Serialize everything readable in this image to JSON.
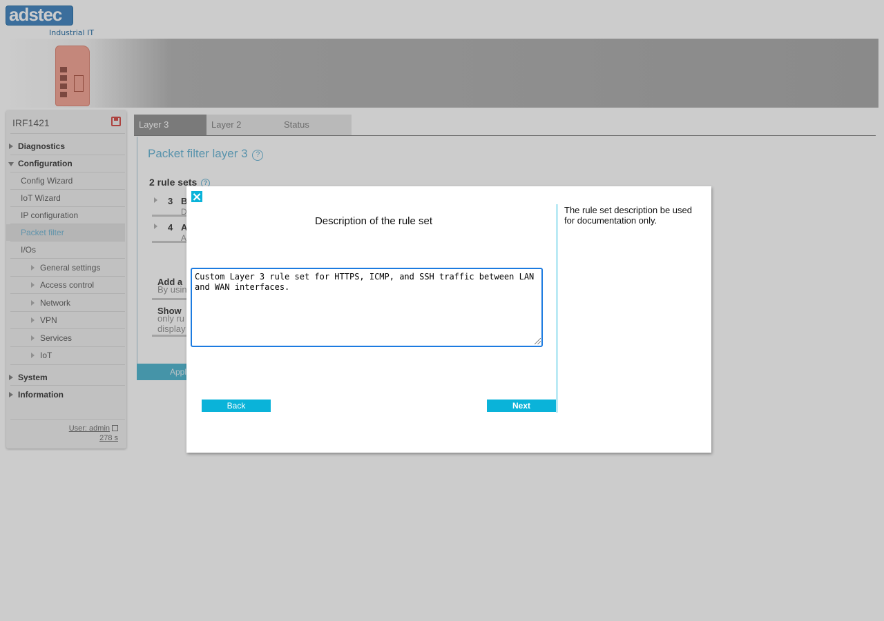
{
  "logo": {
    "text": "adstec",
    "subtitle": "Industrial IT"
  },
  "sidebar": {
    "device_name": "IRF1421",
    "items": [
      {
        "label": "Diagnostics"
      },
      {
        "label": "Configuration"
      },
      {
        "label": "Config Wizard"
      },
      {
        "label": "IoT Wizard"
      },
      {
        "label": "IP configuration"
      },
      {
        "label": "Packet filter"
      },
      {
        "label": "I/Os"
      },
      {
        "label": "General settings"
      },
      {
        "label": "Access control"
      },
      {
        "label": "Network"
      },
      {
        "label": "VPN"
      },
      {
        "label": "Services"
      },
      {
        "label": "IoT"
      },
      {
        "label": "System"
      },
      {
        "label": "Information"
      }
    ],
    "user": "User: admin",
    "timer": "278 s"
  },
  "tabs": [
    "Layer 3",
    "Layer 2",
    "Status"
  ],
  "main": {
    "title": "Packet filter layer 3",
    "rulesets_title": "2 rule sets",
    "rulesets": [
      {
        "num": "3",
        "name_fragment": "B",
        "sub_fragment": "D"
      },
      {
        "num": "4",
        "name_fragment": "A",
        "sub_fragment": "A"
      }
    ],
    "add_title": "Add a",
    "add_text": "By usin",
    "show_title": "Show",
    "show_text_1": "only ru",
    "show_text_2": "display",
    "apply_label": "Appl"
  },
  "dialog": {
    "close_label": "×",
    "title": "Description of the rule set",
    "textarea_value": "Custom Layer 3 rule set for HTTPS, ICMP, and SSH traffic between LAN and WAN interfaces.",
    "help_text": "The rule set description be used for documentation only.",
    "back_label": "Back",
    "next_label": "Next"
  },
  "colors": {
    "accent": "#0ab3d9",
    "title_blue": "#6fb8d8",
    "focus_border": "#1c7be0"
  }
}
